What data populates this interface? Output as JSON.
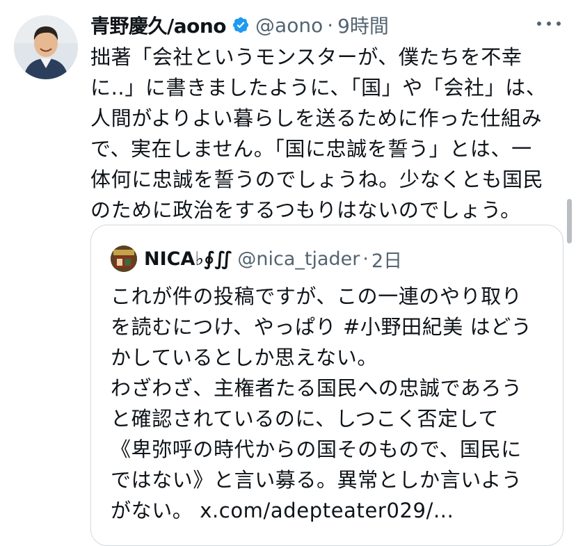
{
  "author": {
    "display_name": "青野慶久/aono",
    "handle": "@aono",
    "time": "9時間",
    "verified_color": "#1d9bf0"
  },
  "tweet": {
    "lines": [
      "拙著「会社というモンスターが、僕たちを不幸",
      "に..」に書きましたように、「国」や「会社」は、",
      "人間がよりよい暮らしを送るために作った仕組み",
      "で、実在しません。「国に忠誠を誓う」とは、一",
      "体何に忠誠を誓うのでしょうね。少なくとも国民",
      "のために政治をするつもりはないのでしょう。"
    ]
  },
  "quote": {
    "display_name": "NICA♭∮∬",
    "handle": "@nica_tjader",
    "time": "2日",
    "lines": [
      "これが件の投稿ですが、この一連のやり取り",
      "を読むにつけ、やっぱり #小野田紀美 はどう",
      "かしているとしか思えない。",
      "わざわざ、主権者たる国民への忠誠であろう",
      "と確認されているのに、しつこく否定して",
      "《卑弥呼の時代からの国そのもので、国民に",
      "ではない》と言い募る。異常としか言いよう",
      "がない。 x.com/adepteater029/..."
    ]
  },
  "icons": {
    "more": "more-icon",
    "verified": "verified-badge-icon"
  }
}
